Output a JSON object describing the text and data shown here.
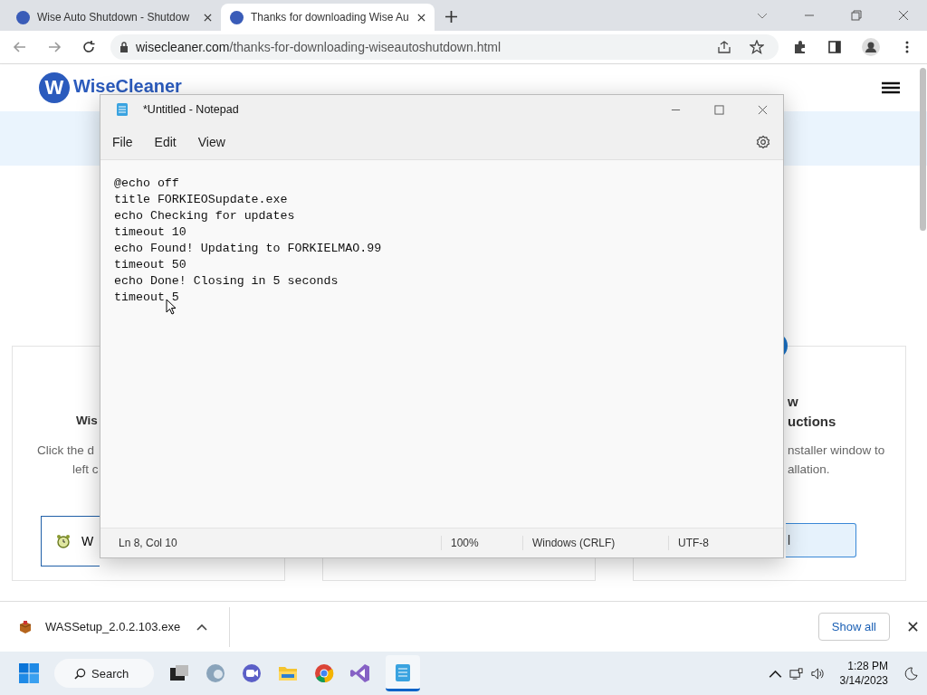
{
  "browser": {
    "tabs": [
      {
        "title": "Wise Auto Shutdown - Shutdow",
        "selected": false
      },
      {
        "title": "Thanks for downloading Wise Au",
        "selected": true
      }
    ],
    "url_host": "wisecleaner.com",
    "url_path": "/thanks-for-downloading-wiseautoshutdown.html"
  },
  "page": {
    "logo_letter": "W",
    "logo_text": "WiseCleaner",
    "cards": [
      {
        "title": "Wis",
        "lines": [
          "Click the d",
          "left c"
        ],
        "button": "W"
      },
      {
        "title_lines": [
          "w",
          "uctions"
        ],
        "lines": [
          "nstaller window to",
          "allation."
        ],
        "button": "l"
      }
    ]
  },
  "notepad": {
    "title": "*Untitled - Notepad",
    "menu": [
      "File",
      "Edit",
      "View"
    ],
    "lines": [
      "@echo off",
      "title FORKIEOSupdate.exe",
      "echo Checking for updates",
      "timeout 10",
      "echo Found! Updating to FORKIELMAO.99",
      "timeout 50",
      "echo Done! Closing in 5 seconds",
      "timeout 5"
    ],
    "status": [
      "Ln 8, Col 10",
      "100%",
      "Windows (CRLF)",
      "UTF-8"
    ]
  },
  "downloads": {
    "file": "WASSetup_2.0.2.103.exe",
    "show_all": "Show all"
  },
  "taskbar": {
    "search": "Search",
    "time": "1:28 PM",
    "date": "3/14/2023"
  }
}
